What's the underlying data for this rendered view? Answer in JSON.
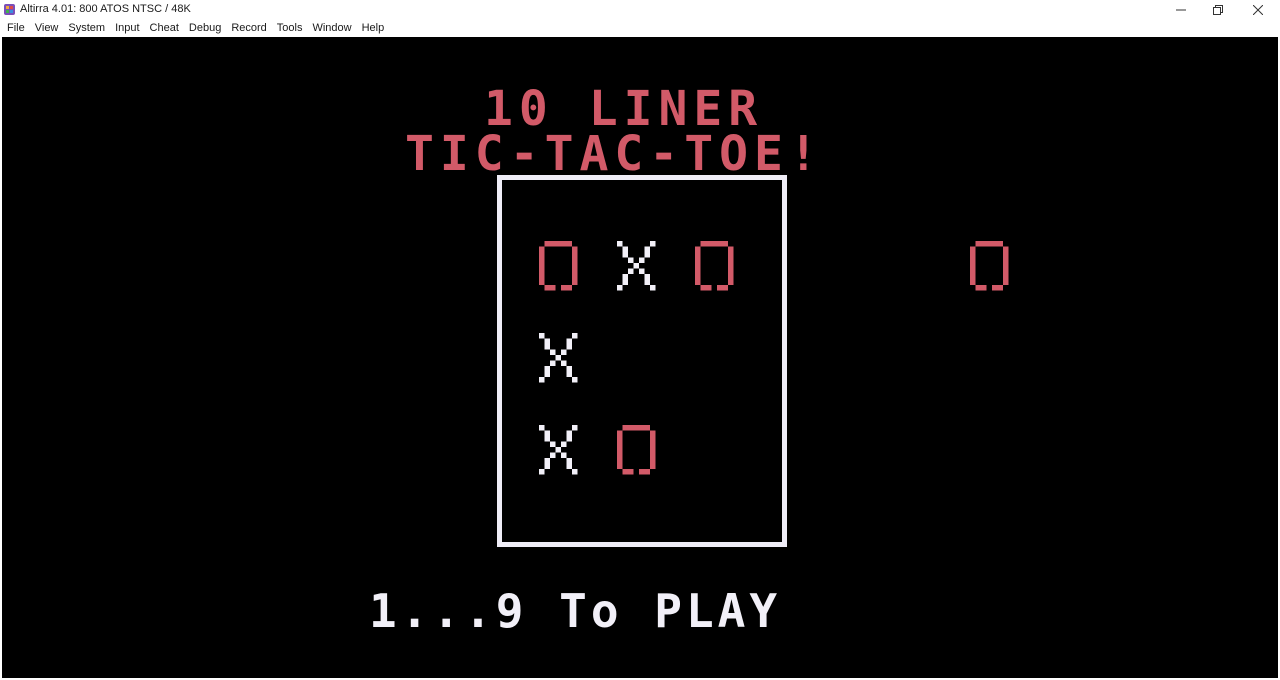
{
  "window": {
    "title": "Altirra 4.01: 800 ATOS NTSC / 48K",
    "app_icon": "altirra-logo-icon",
    "controls": [
      "minimize-icon",
      "restore-icon",
      "close-icon"
    ]
  },
  "menu": {
    "items": [
      "File",
      "View",
      "System",
      "Input",
      "Cheat",
      "Debug",
      "Record",
      "Tools",
      "Window",
      "Help"
    ]
  },
  "game": {
    "title_line1": "10 LINER",
    "title_line2": "TIC-TAC-TOE!",
    "prompt": "1...9 To PLAY",
    "board": [
      [
        "O",
        "X",
        "O"
      ],
      [
        "X",
        "",
        ""
      ],
      [
        "X",
        "O",
        ""
      ]
    ],
    "next_piece": "O",
    "colors": {
      "background": "#000000",
      "o_mark": "#d25a68",
      "x_mark": "#f2f0f8",
      "board_border": "#efedf7",
      "title_text": "#d25a68",
      "prompt_text": "#f2f0f8"
    }
  }
}
